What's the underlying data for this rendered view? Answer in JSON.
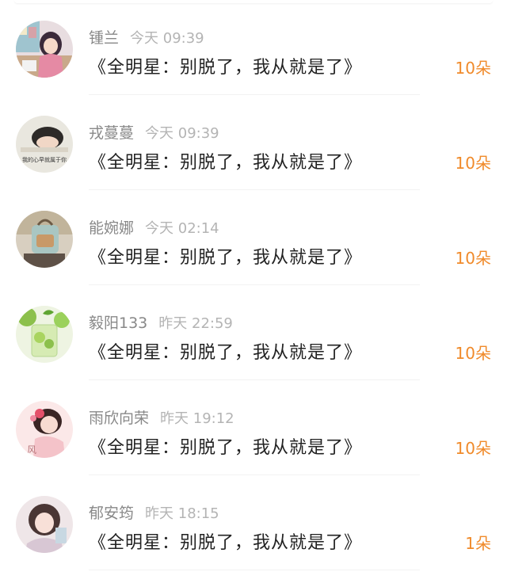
{
  "colors": {
    "name": "#888888",
    "time": "#b4b4b4",
    "title": "#222222",
    "amount": "#f08a2a"
  },
  "items": [
    {
      "name": "锺兰",
      "time": "今天 09:39",
      "title": "《全明星：别脱了，我从就是了》",
      "amount": "10朵",
      "avatar": "avatar-girl-drawing"
    },
    {
      "name": "戎蔓蔓",
      "time": "今天 09:39",
      "title": "《全明星：别脱了，我从就是了》",
      "amount": "10朵",
      "avatar": "avatar-sleeping-girl",
      "avatar_text": "我的心早就属于你"
    },
    {
      "name": "能婉娜",
      "time": "今天 02:14",
      "title": "《全明星：别脱了，我从就是了》",
      "amount": "10朵",
      "avatar": "avatar-backpack"
    },
    {
      "name": "毅阳133",
      "time": "昨天 22:59",
      "title": "《全明星：别脱了，我从就是了》",
      "amount": "10朵",
      "avatar": "avatar-lime-drink"
    },
    {
      "name": "雨欣向荣",
      "time": "昨天 19:12",
      "title": "《全明星：别脱了，我从就是了》",
      "amount": "10朵",
      "avatar": "avatar-girl-flowers",
      "avatar_text": "风"
    },
    {
      "name": "郁安筠",
      "time": "昨天 18:15",
      "title": "《全明星：别脱了，我从就是了》",
      "amount": "1朵",
      "avatar": "avatar-girl-portrait"
    }
  ]
}
